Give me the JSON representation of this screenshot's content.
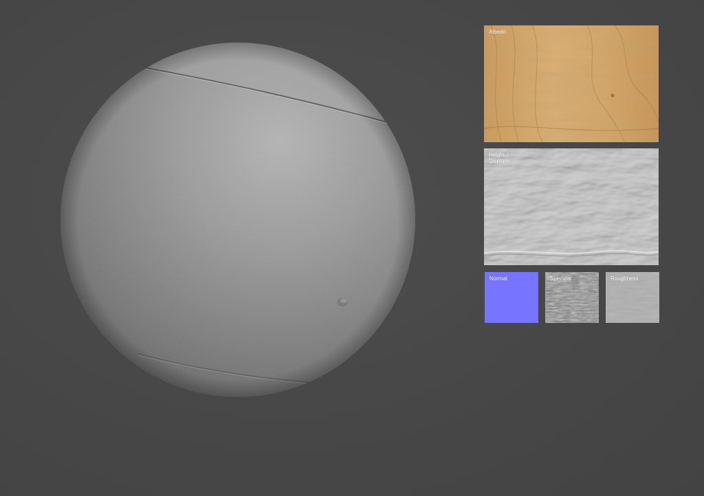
{
  "preview": {
    "object": "material-preview-sphere"
  },
  "maps": {
    "albedo": {
      "label": "Albedo",
      "tint": "#d4a971"
    },
    "height": {
      "label": "Height /\nDisplace",
      "tint": "#b9b9b9"
    },
    "normal": {
      "label": "Normal",
      "tint": "#7774ff"
    },
    "specular": {
      "label": "Specular",
      "tint": "#8a8a8a"
    },
    "roughness": {
      "label": "Roughness",
      "tint": "#a9a9a9"
    }
  },
  "colors": {
    "background": "#474747",
    "sphere": "#8a8a8a"
  }
}
